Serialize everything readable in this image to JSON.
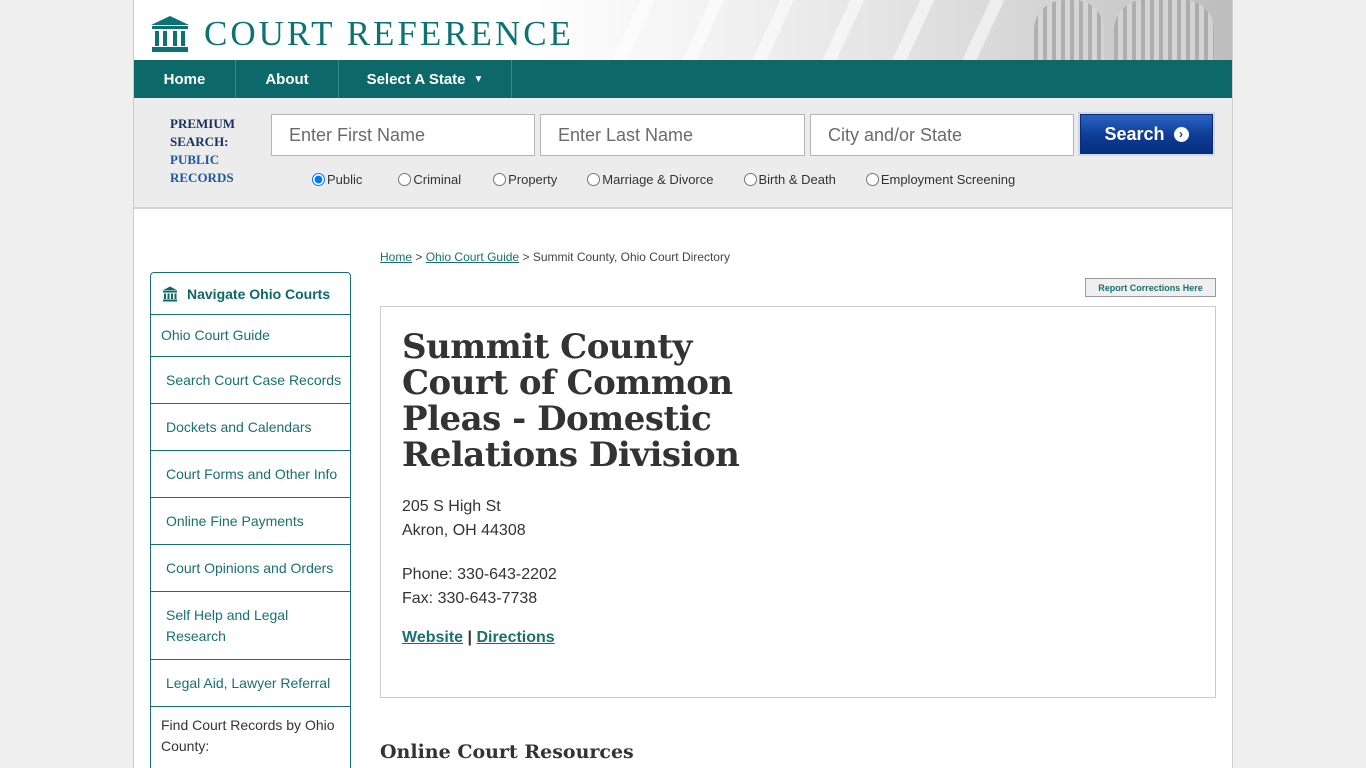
{
  "brand": {
    "name": "COURT REFERENCE",
    "accent": "#0c6869",
    "logo_icon": "courthouse-icon"
  },
  "nav": {
    "home": "Home",
    "about": "About",
    "select_state": "Select A State",
    "select_state_icon": "caret-down-icon"
  },
  "search": {
    "label_line1": "PREMIUM",
    "label_line2": "SEARCH:",
    "label_line3": "PUBLIC",
    "label_line4": "RECORDS",
    "first_name_placeholder": "Enter First Name",
    "last_name_placeholder": "Enter Last Name",
    "city_state_placeholder": "City and/or State",
    "button_label": "Search",
    "button_icon": "chevron-right-icon",
    "options": [
      "Public",
      "Criminal",
      "Property",
      "Marriage & Divorce",
      "Birth & Death",
      "Employment Screening"
    ],
    "selected_option": "Public"
  },
  "breadcrumb": {
    "home": "Home",
    "separator": ">",
    "guide": "Ohio Court Guide",
    "current": "Summit County, Ohio Court Directory"
  },
  "report_button": "Report Corrections Here",
  "sidebar": {
    "title": "Navigate Ohio Courts",
    "title_icon": "courthouse-icon",
    "first_item": "Ohio Court Guide",
    "items": [
      "Search Court Case Records",
      "Dockets and Calendars",
      "Court Forms and Other Info",
      "Online Fine Payments",
      "Court Opinions and Orders",
      "Self Help and Legal Research",
      "Legal Aid, Lawyer Referral"
    ],
    "footer": "Find Court Records by Ohio County:"
  },
  "court": {
    "name": "Summit County Court of Common Pleas - Domestic Relations Division",
    "street": "205 S High St",
    "city_line": "Akron, OH 44308",
    "phone": "Phone: 330-643-2202",
    "fax": "Fax: 330-643-7738",
    "website_link": "Website",
    "link_separator": "|",
    "directions_link": "Directions"
  },
  "section_heading": "Online Court Resources"
}
